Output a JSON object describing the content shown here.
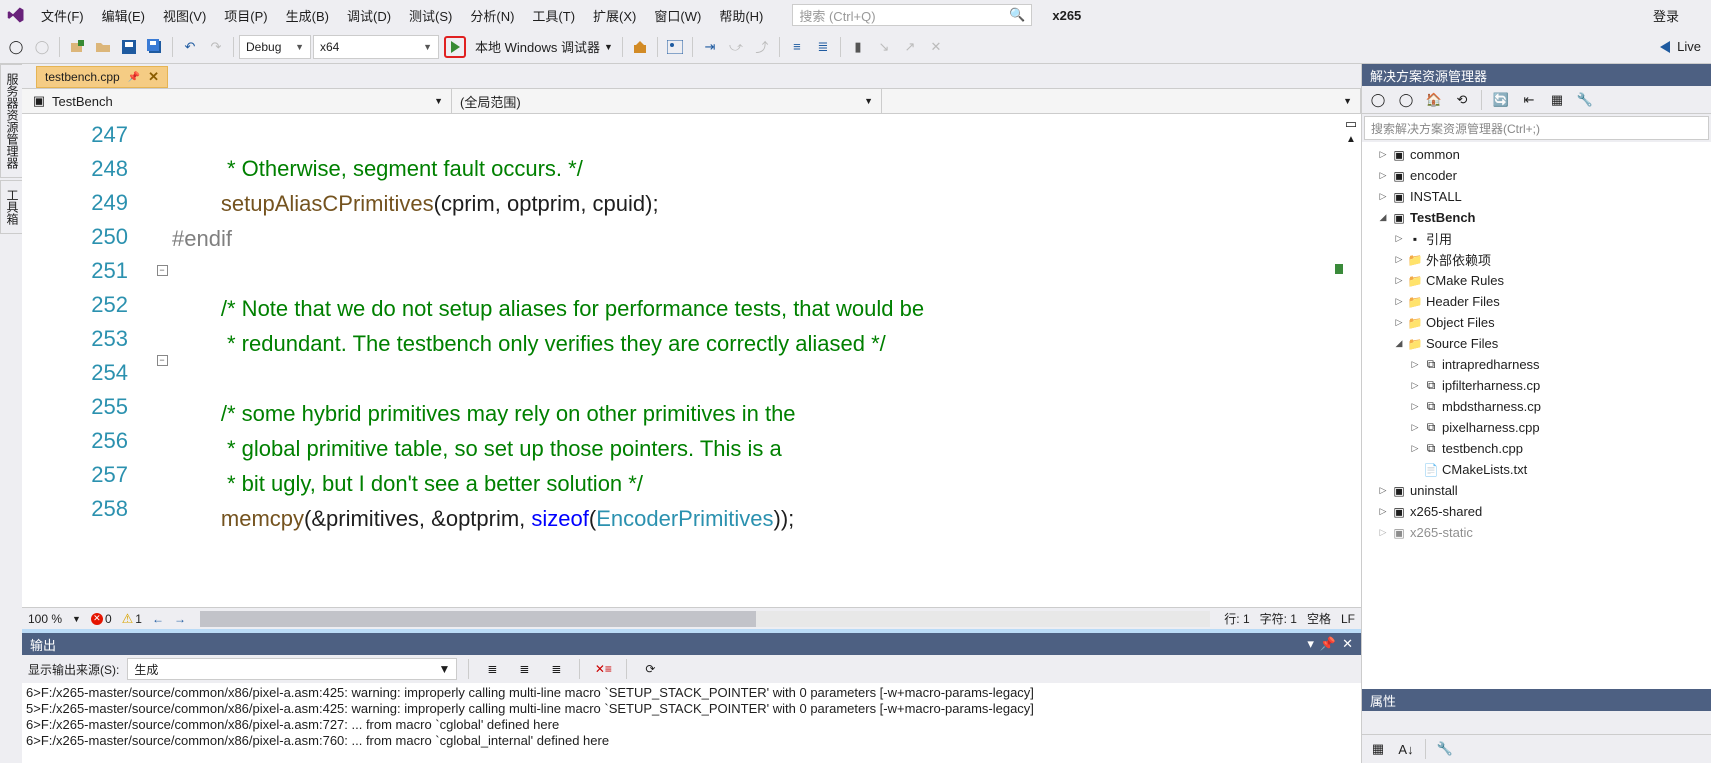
{
  "menu": {
    "file": "文件(F)",
    "edit": "编辑(E)",
    "view": "视图(V)",
    "project": "项目(P)",
    "build": "生成(B)",
    "debug": "调试(D)",
    "test": "测试(S)",
    "analyze": "分析(N)",
    "tools": "工具(T)",
    "extensions": "扩展(X)",
    "window": "窗口(W)",
    "help": "帮助(H)"
  },
  "search_placeholder": "搜索 (Ctrl+Q)",
  "project_name": "x265",
  "login": "登录",
  "toolbar": {
    "config": "Debug",
    "platform": "x64",
    "debugger": "本地 Windows 调试器",
    "live": "Live"
  },
  "side": {
    "server": "服务器资源管理器",
    "toolbox": "工具箱"
  },
  "tab": {
    "name": "testbench.cpp"
  },
  "nav": {
    "scope1": "TestBench",
    "scope2": "(全局范围)",
    "scope3": ""
  },
  "code": {
    "lines": [
      247,
      248,
      249,
      250,
      251,
      252,
      253,
      254,
      255,
      256,
      257,
      258
    ],
    "l247": "         * Otherwise, segment fault occurs. */",
    "l248a": "        ",
    "l248b": "setupAliasCPrimitives",
    "l248c": "(cprim, optprim, cpuid);",
    "l249": "#endif",
    "l250": "",
    "l251": "        /* Note that we do not setup aliases for performance tests, that would be",
    "l252": "         * redundant. The testbench only verifies they are correctly aliased */",
    "l253": "",
    "l254": "        /* some hybrid primitives may rely on other primitives in the",
    "l255": "         * global primitive table, so set up those pointers. This is a",
    "l256": "         * bit ugly, but I don't see a better solution */",
    "l257a": "        ",
    "l257b": "memcpy",
    "l257c": "(&primitives, &optprim, ",
    "l257d": "sizeof",
    "l257e": "(",
    "l257f": "EncoderPrimitives",
    "l257g": "));",
    "l258": ""
  },
  "status": {
    "zoom": "100 %",
    "errors": "0",
    "warnings": "1",
    "line": "行: 1",
    "col": "字符: 1",
    "spaces": "空格",
    "le": "LF"
  },
  "output": {
    "title": "输出",
    "source_label": "显示输出来源(S):",
    "source_value": "生成",
    "lines": [
      "6>F:/x265-master/source/common/x86/pixel-a.asm:425: warning: improperly calling multi-line macro `SETUP_STACK_POINTER' with 0 parameters [-w+macro-params-legacy]",
      "5>F:/x265-master/source/common/x86/pixel-a.asm:425: warning: improperly calling multi-line macro `SETUP_STACK_POINTER' with 0 parameters [-w+macro-params-legacy]",
      "6>F:/x265-master/source/common/x86/pixel-a.asm:727: ... from macro `cglobal' defined here",
      "6>F:/x265-master/source/common/x86/pixel-a.asm:760: ... from macro `cglobal_internal' defined here"
    ]
  },
  "sln": {
    "title": "解决方案资源管理器",
    "search": "搜索解决方案资源管理器(Ctrl+;)",
    "nodes": {
      "common": "common",
      "encoder": "encoder",
      "install": "INSTALL",
      "testbench": "TestBench",
      "refs": "引用",
      "external": "外部依赖项",
      "cmake": "CMake Rules",
      "headers": "Header Files",
      "objects": "Object Files",
      "sources": "Source Files",
      "f1": "intrapredharness",
      "f2": "ipfilterharness.cp",
      "f3": "mbdstharness.cp",
      "f4": "pixelharness.cpp",
      "f5": "testbench.cpp",
      "cmakelists": "CMakeLists.txt",
      "uninstall": "uninstall",
      "shared": "x265-shared",
      "static": "x265-static"
    }
  },
  "props": {
    "title": "属性"
  }
}
